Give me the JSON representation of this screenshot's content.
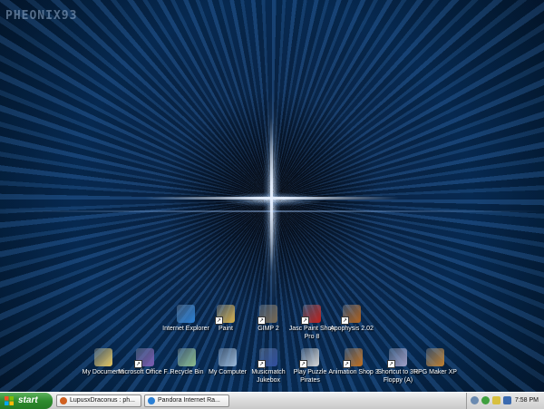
{
  "desktop": {
    "watermark": "PHEONIX93",
    "icons_row1": [
      {
        "label": "Internet Explorer",
        "icon": "internet-explorer-icon",
        "color": "#2a7fd4",
        "shortcut": false
      },
      {
        "label": "Paint",
        "icon": "paint-icon",
        "color": "#d8b04a",
        "shortcut": true
      },
      {
        "label": "GIMP 2",
        "icon": "gimp-icon",
        "color": "#7a6a52",
        "shortcut": true
      },
      {
        "label": "Jasc Paint Shop Pro 8",
        "icon": "paint-shop-pro-icon",
        "color": "#c0201a",
        "shortcut": true
      },
      {
        "label": "Apophysis 2.02",
        "icon": "apophysis-icon",
        "color": "#b0601a",
        "shortcut": true
      }
    ],
    "icons_row2": [
      {
        "label": "My Documents",
        "icon": "my-documents-icon",
        "color": "#e8c860",
        "shortcut": false
      },
      {
        "label": "Microsoft Office F...",
        "icon": "microsoft-office-icon",
        "color": "#7a5ab0",
        "shortcut": true
      },
      {
        "label": "Recycle Bin",
        "icon": "recycle-bin-icon",
        "color": "#8fbf8f",
        "shortcut": false
      },
      {
        "label": "My Computer",
        "icon": "my-computer-icon",
        "color": "#9ab8d8",
        "shortcut": false
      },
      {
        "label": "Musicmatch Jukebox",
        "icon": "musicmatch-icon",
        "color": "#3050a0",
        "shortcut": true
      },
      {
        "label": "Play Puzzle Pirates",
        "icon": "puzzle-pirates-icon",
        "color": "#d8d8d8",
        "shortcut": true
      },
      {
        "label": "Animation Shop 3",
        "icon": "animation-shop-icon",
        "color": "#c07020",
        "shortcut": true
      },
      {
        "label": "Shortcut to 3½ Floppy (A)",
        "icon": "floppy-drive-icon",
        "color": "#a0a0c8",
        "shortcut": true
      },
      {
        "label": "RPG Maker XP",
        "icon": "rpg-maker-icon",
        "color": "#c08030",
        "shortcut": false
      }
    ]
  },
  "taskbar": {
    "start_label": "start",
    "tasks": [
      {
        "label": "LupusxDraconus : ph...",
        "icon": "firefox-icon",
        "color": "#d06020"
      },
      {
        "label": "Pandora Internet Ra...",
        "icon": "internet-explorer-icon",
        "color": "#2a7fd4"
      }
    ],
    "clock": "7:58 PM"
  },
  "colors": {
    "accent_green": "#2e8b2e",
    "desktop_blue": "#08305e"
  }
}
